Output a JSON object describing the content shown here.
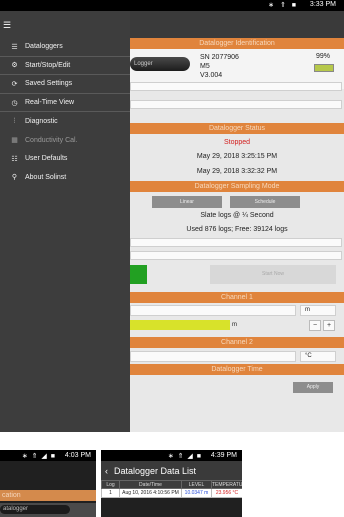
{
  "main": {
    "status_bar": {
      "icons": "∗ ⇑ ■",
      "time": "3:33 PM"
    },
    "menu_icon": "hamburger-icon",
    "drawer": {
      "items": [
        {
          "label": "Dataloggers",
          "icon": "list-icon",
          "enabled": true
        },
        {
          "label": "Start/Stop/Edit",
          "icon": "settings-icon",
          "enabled": true
        },
        {
          "label": "Saved Settings",
          "icon": "refresh-icon",
          "enabled": true
        },
        {
          "label": "Real-Time View",
          "icon": "clock-icon",
          "enabled": true
        },
        {
          "label": "Diagnostic",
          "icon": "sliders-icon",
          "enabled": true
        },
        {
          "label": "Conductivity Cal.",
          "icon": "chart-icon",
          "enabled": false
        },
        {
          "label": "User Defaults",
          "icon": "user-list-icon",
          "enabled": true
        },
        {
          "label": "About Solinst",
          "icon": "person-icon",
          "enabled": true
        }
      ]
    },
    "app": {
      "logger_identification_header": "Datalogger Identification",
      "logger_image_label": "Logger",
      "serial": "SN 2077906",
      "model": "M5",
      "version": "V3.004",
      "battery_pct": "99%",
      "status_header": "Datalogger Status",
      "status": "Stopped",
      "start_time": "May 29, 2018 3:25:15 PM",
      "stop_time": "May 29, 2018 3:32:32 PM",
      "sampling_header": "Datalogger Sampling Mode",
      "mode_linear": "Linear",
      "mode_schedule": "Schedule",
      "sampling_rate": "Slate logs @ ¼ Second",
      "memory_usage": "Used 876 logs; Free: 39124 logs",
      "save_button": "Start Now",
      "channel1_header": "Channel 1",
      "channel1_unit_select": "m",
      "level_unit": "m",
      "channel2_header": "Channel 2",
      "channel2_unit_select": "°C",
      "time_header": "Datalogger Time",
      "apply_button": "Apply",
      "minus": "−",
      "plus": "+"
    }
  },
  "thumb1": {
    "status_bar": {
      "icons": "∗ ⇑ ◢ ■",
      "time": "4:03 PM"
    },
    "section_header": "cation",
    "logger_label": "atalogger"
  },
  "thumb2": {
    "status_bar": {
      "icons": "∗ ⇑ ◢ ■",
      "time": "4:39 PM"
    },
    "title": "Datalogger Data List",
    "columns": [
      "Log",
      "Date/Time",
      "LEVEL",
      "TEMPERATU..."
    ],
    "rows": [
      {
        "log": "1",
        "datetime": "Aug 10, 2016 4:10:56 PM",
        "level": "10.0347 m",
        "temp": "23.956 °C"
      }
    ]
  }
}
